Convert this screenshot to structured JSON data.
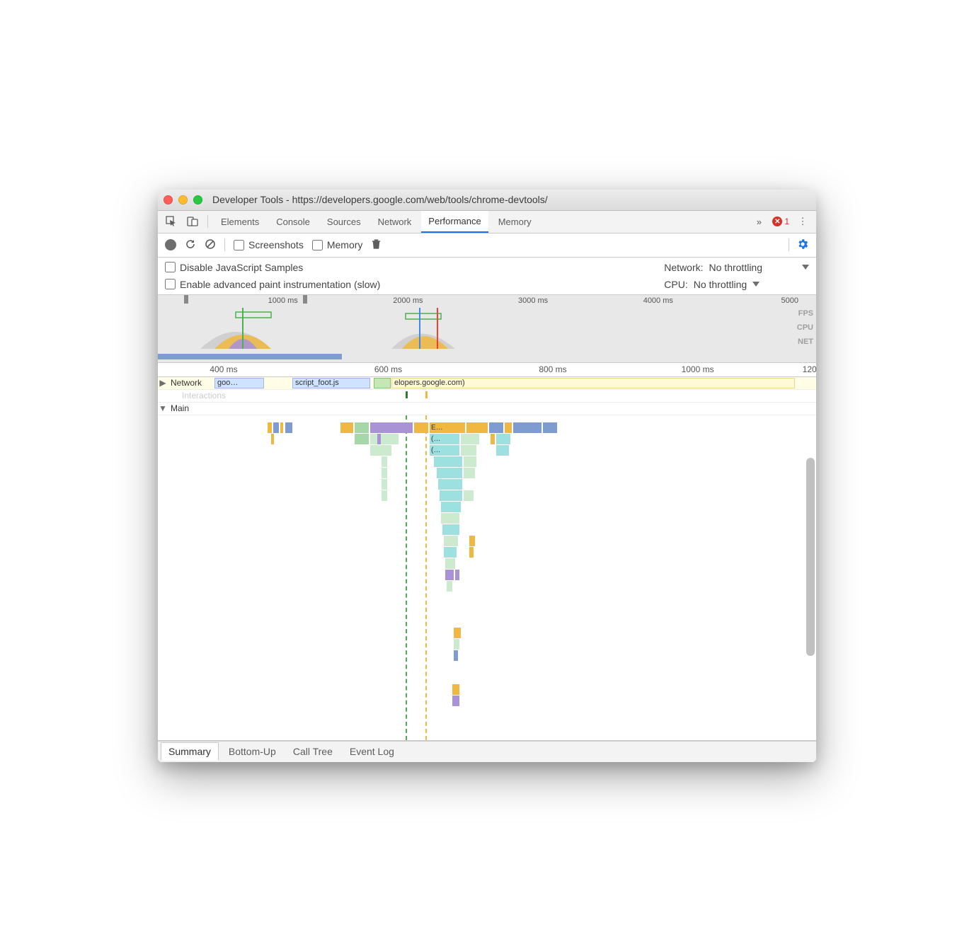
{
  "window": {
    "title": "Developer Tools - https://developers.google.com/web/tools/chrome-devtools/"
  },
  "tabs": {
    "items": [
      "Elements",
      "Console",
      "Sources",
      "Network",
      "Performance",
      "Memory"
    ],
    "active": "Performance",
    "overflow_glyph": "»",
    "error_count": "1"
  },
  "toolbar": {
    "screenshots_label": "Screenshots",
    "memory_label": "Memory"
  },
  "options": {
    "disable_js_label": "Disable JavaScript Samples",
    "paint_label": "Enable advanced paint instrumentation (slow)",
    "network_label": "Network:",
    "network_value": "No throttling",
    "cpu_label": "CPU:",
    "cpu_value": "No throttling"
  },
  "overview": {
    "ticks": [
      "1000 ms",
      "2000 ms",
      "3000 ms",
      "4000 ms",
      "5000"
    ],
    "tick_positions_pct": [
      19,
      38,
      57,
      76,
      96
    ],
    "labels": {
      "fps": "FPS",
      "cpu": "CPU",
      "net": "NET"
    }
  },
  "ruler": {
    "ticks": [
      "400 ms",
      "600 ms",
      "800 ms",
      "1000 ms",
      "120"
    ],
    "positions_pct": [
      10,
      35,
      60,
      82,
      99
    ]
  },
  "tracks": {
    "network_label": "Network",
    "interactions_label": "Interactions",
    "main_label": "Main",
    "net_items": [
      {
        "text": "goo…",
        "left_pct": 3,
        "width_pct": 10,
        "cls": ""
      },
      {
        "text": "script_foot.js",
        "left_pct": 18,
        "width_pct": 13,
        "cls": ""
      },
      {
        "text": "",
        "left_pct": 31.5,
        "width_pct": 3,
        "cls": "green"
      },
      {
        "text": "elopers.google.com)",
        "left_pct": 35,
        "width_pct": 60,
        "cls": ""
      }
    ],
    "flame_labels": {
      "e": "E…",
      "p1": "(…",
      "p2": "(…"
    }
  },
  "bottom_tabs": {
    "items": [
      "Summary",
      "Bottom-Up",
      "Call Tree",
      "Event Log"
    ],
    "active": "Summary"
  }
}
